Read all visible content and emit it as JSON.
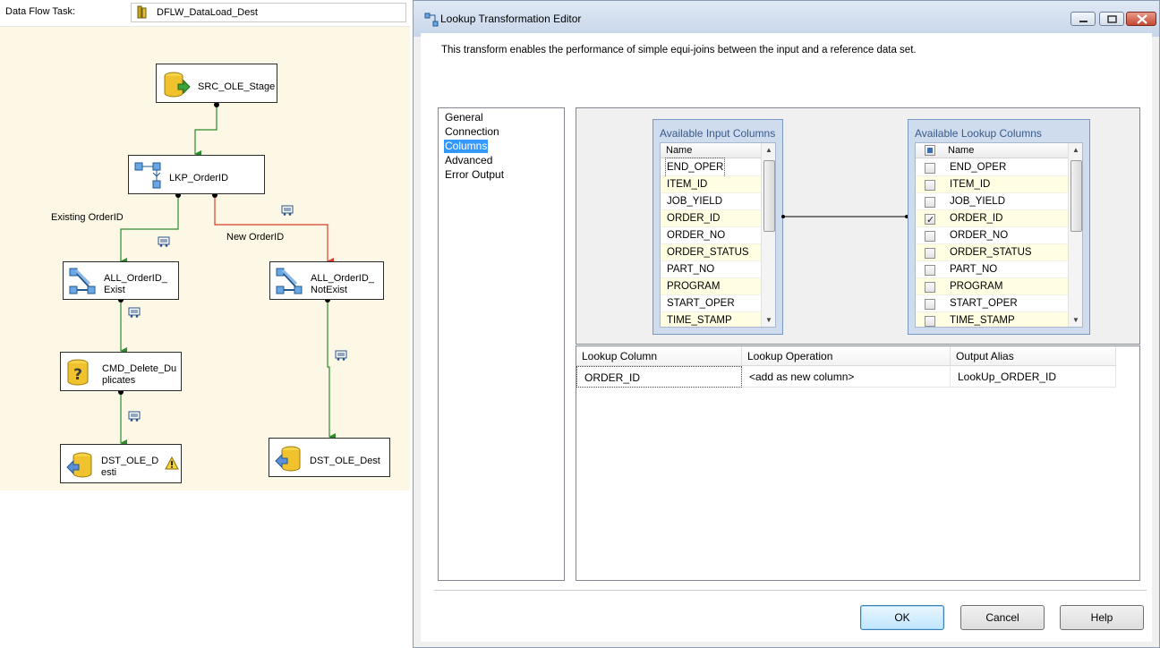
{
  "designer": {
    "task_label": "Data Flow Task:",
    "task_value": "DFLW_DataLoad_Dest",
    "components": {
      "src": "SRC_OLE_Stage",
      "lkp": "LKP_OrderID",
      "all_exist": "ALL_OrderID_\nExist",
      "all_notexist": "ALL_OrderID_\nNotExist",
      "cmd": "CMD_Delete_Du\nplicates",
      "dst_desti": "DST_OLE_D\nesti",
      "dst_dest": "DST_OLE_Dest"
    },
    "paths": {
      "existing": "Existing OrderID",
      "new": "New OrderID"
    },
    "colors": {
      "canvas": "#fdf8e6",
      "match_path": "#2d8a2d",
      "nomatch_path": "#e03b2b"
    }
  },
  "dialog": {
    "title": "Lookup Transformation Editor",
    "description": "This transform enables the performance of simple equi-joins between the input and a reference data set.",
    "nav": [
      "General",
      "Connection",
      "Columns",
      "Advanced",
      "Error Output"
    ],
    "nav_selected": "Columns",
    "input_columns": {
      "title": "Available Input Columns",
      "header": "Name",
      "items": [
        "END_OPER",
        "ITEM_ID",
        "JOB_YIELD",
        "ORDER_ID",
        "ORDER_NO",
        "ORDER_STATUS",
        "PART_NO",
        "PROGRAM",
        "START_OPER",
        "TIME_STAMP"
      ]
    },
    "lookup_columns": {
      "title": "Available Lookup Columns",
      "header": "Name",
      "items": [
        "END_OPER",
        "ITEM_ID",
        "JOB_YIELD",
        "ORDER_ID",
        "ORDER_NO",
        "ORDER_STATUS",
        "PART_NO",
        "PROGRAM",
        "START_OPER",
        "TIME_STAMP"
      ],
      "checked": [
        "ORDER_ID"
      ]
    },
    "grid": {
      "headers": [
        "Lookup Column",
        "Lookup Operation",
        "Output Alias"
      ],
      "rows": [
        [
          "ORDER_ID",
          "<add as new column>",
          "LookUp_ORDER_ID"
        ]
      ]
    },
    "buttons": {
      "ok": "OK",
      "cancel": "Cancel",
      "help": "Help"
    }
  }
}
